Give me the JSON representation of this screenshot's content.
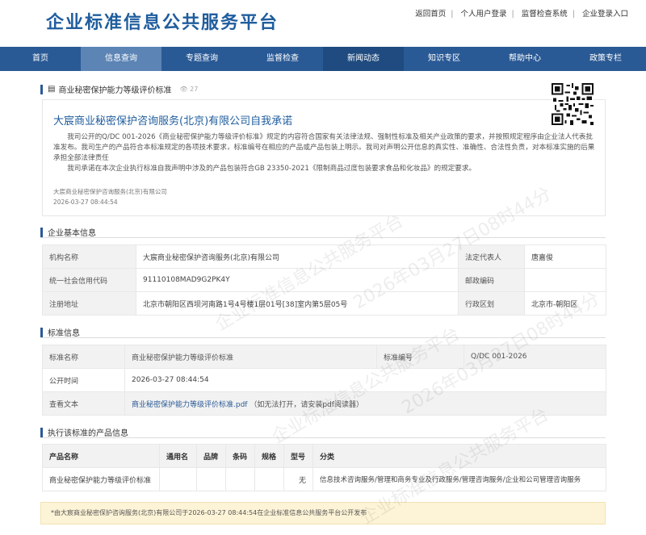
{
  "site": {
    "title": "企业标准信息公共服务平台",
    "toplinks": [
      "返回首页",
      "个人用户登录",
      "监督检查系统",
      "企业登录入口"
    ]
  },
  "nav": {
    "items": [
      {
        "label": "首页",
        "state": "normal"
      },
      {
        "label": "信息查询",
        "state": "active"
      },
      {
        "label": "专题查询",
        "state": "normal"
      },
      {
        "label": "监督检查",
        "state": "normal"
      },
      {
        "label": "新闻动态",
        "state": "dark"
      },
      {
        "label": "知识专区",
        "state": "normal"
      },
      {
        "label": "帮助中心",
        "state": "normal"
      },
      {
        "label": "政策专栏",
        "state": "normal"
      }
    ]
  },
  "standard_header": {
    "title": "商业秘密保护能力等级评价标准",
    "views": "27"
  },
  "commitment": {
    "title": "大宸商业秘密保护咨询服务(北京)有限公司自我承诺",
    "para1": "我司公开的Q/DC 001-2026《商业秘密保护能力等级评价标准》规定的内容符合国家有关法律法规、强制性标准及相关产业政策的要求，并按照规定程序由企业法人代表批准发布。我司生产的产品符合本标准规定的各项技术要求，标准编号在相应的产品或产品包装上明示。我司对声明公开信息的真实性、准确性、合法性负责，对本标准实施的后果承担全部法律责任",
    "para2": "我司承诺在本次企业执行标准自我声明中涉及的产品包装符合GB 23350-2021《限制商品过度包装要求食品和化妆品》的规定要求。",
    "footer_company": "大宸商业秘密保护咨询服务(北京)有限公司",
    "footer_time": "2026-03-27 08:44:54"
  },
  "company_info": {
    "heading": "企业基本信息",
    "name_label": "机构名称",
    "name_value": "大宸商业秘密保护咨询服务(北京)有限公司",
    "rep_label": "法定代表人",
    "rep_value": "唐嘉俊",
    "code_label": "统一社会信用代码",
    "code_value": "91110108MAD9G2PK4Y",
    "zip_label": "邮政编码",
    "zip_value": "",
    "addr_label": "注册地址",
    "addr_value": "北京市朝阳区西坝河南路1号4号楼1层01号[38]室内第5层05号",
    "region_label": "行政区划",
    "region_value": "北京市-朝阳区"
  },
  "standard_info": {
    "heading": "标准信息",
    "name_label": "标准名称",
    "name_value": "商业秘密保护能力等级评价标准",
    "no_label": "标准编号",
    "no_value": "Q/DC 001-2026",
    "time_label": "公开时间",
    "time_value": "2026-03-27 08:44:54",
    "text_label": "查看文本",
    "text_link": "商业秘密保护能力等级评价标准.pdf",
    "text_hint": "（如无法打开，请安装pdf阅读器）"
  },
  "products": {
    "heading": "执行该标准的产品信息",
    "headers": [
      "产品名称",
      "通用名",
      "品牌",
      "条码",
      "规格",
      "型号",
      "分类"
    ],
    "rows": [
      [
        "商业秘密保护能力等级评价标准",
        "",
        "",
        "",
        "",
        "无",
        "信息技术咨询服务/管理和商务专业及行政服务/管理咨询服务/企业和公司管理咨询服务"
      ]
    ]
  },
  "notice": "*由大宸商业秘密保护咨询服务(北京)有限公司于2026-03-27 08:44:54在企业标准信息公共服务平台公开发布",
  "watermark": [
    "企业标准信息公共服务平台",
    "2026年03月27日08时44分"
  ]
}
